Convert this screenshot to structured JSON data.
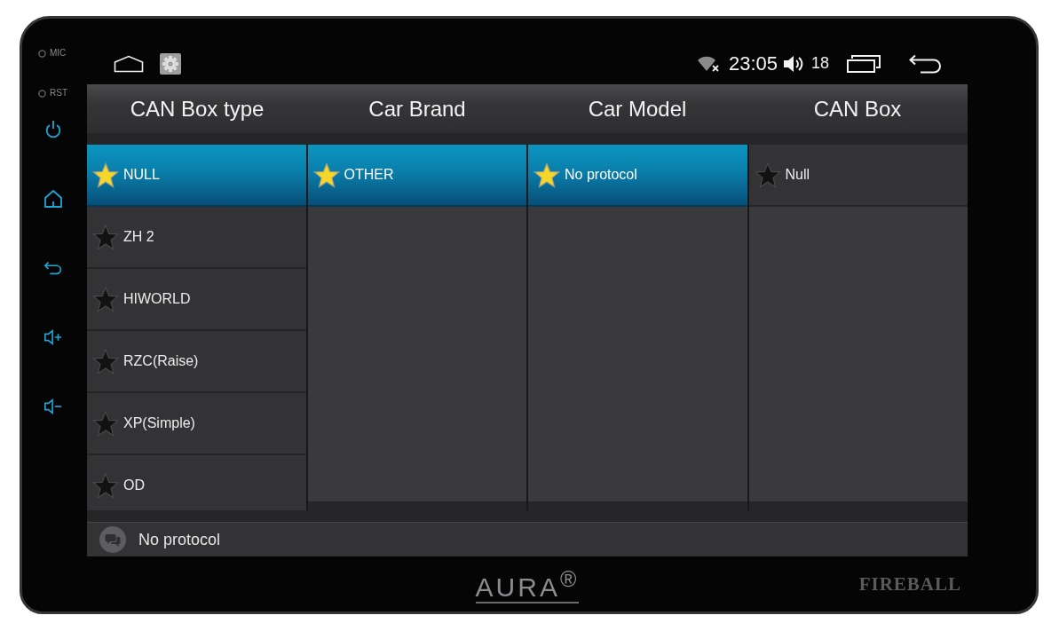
{
  "bezel": {
    "side_labels": [
      "MIC",
      "RST"
    ],
    "logo": "AURA$^{®}$",
    "model": "FIREBALL"
  },
  "status_bar": {
    "time": "23:05",
    "volume": "18"
  },
  "columns": [
    {
      "title": "CAN Box type",
      "items": [
        {
          "label": "NULL",
          "selected": true
        },
        {
          "label": "ZH 2",
          "selected": false
        },
        {
          "label": "HIWORLD",
          "selected": false
        },
        {
          "label": "RZC(Raise)",
          "selected": false
        },
        {
          "label": "XP(Simple)",
          "selected": false
        },
        {
          "label": "OD",
          "selected": false
        }
      ]
    },
    {
      "title": "Car Brand",
      "items": [
        {
          "label": "OTHER",
          "selected": true
        }
      ]
    },
    {
      "title": "Car Model",
      "items": [
        {
          "label": "No protocol",
          "selected": true
        }
      ]
    },
    {
      "title": "CAN Box",
      "items": [
        {
          "label": "Null",
          "selected": false
        }
      ]
    }
  ],
  "footer": {
    "text": "No protocol"
  }
}
